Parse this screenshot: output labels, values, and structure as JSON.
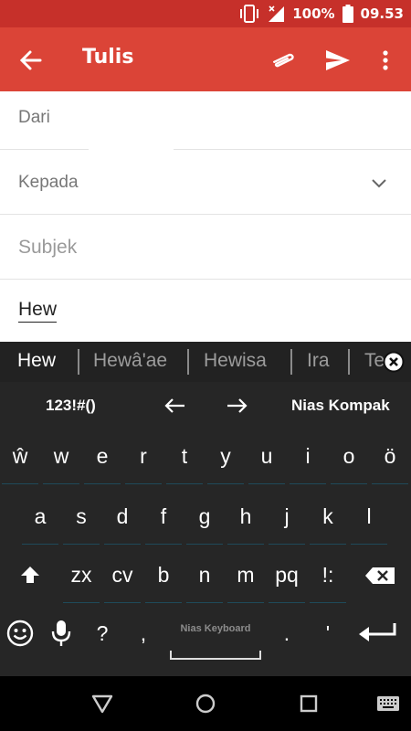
{
  "status": {
    "battery": "100%",
    "time": "09.53",
    "icons": [
      "vibrate-icon",
      "no-signal-icon",
      "battery-icon"
    ]
  },
  "appbar": {
    "title": "Tulis",
    "icons": [
      "back-arrow-icon",
      "attach-icon",
      "send-icon",
      "more-vert-icon"
    ],
    "color": "#db4437"
  },
  "form": {
    "from_label": "Dari",
    "to_label": "Kepada",
    "subject_placeholder": "Subjek",
    "body_text": "Hew"
  },
  "keyboard": {
    "suggestions": [
      "Hew",
      "Hewâ'ae",
      "Hewisa",
      "Ira",
      "Te"
    ],
    "tool_row": {
      "symbols": "123!#()",
      "layout": "Nias Kompak"
    },
    "row1": [
      "ŵ",
      "w",
      "e",
      "r",
      "t",
      "y",
      "u",
      "i",
      "o",
      "ö"
    ],
    "row2": [
      "a",
      "s",
      "d",
      "f",
      "g",
      "h",
      "j",
      "k",
      "l"
    ],
    "row3": [
      "zx",
      "cv",
      "b",
      "n",
      "m",
      "pq",
      "!:"
    ],
    "row4": {
      "question": "?",
      "comma": ",",
      "space_label": "Nias Keyboard",
      "period": ".",
      "apostrophe": "'"
    }
  }
}
